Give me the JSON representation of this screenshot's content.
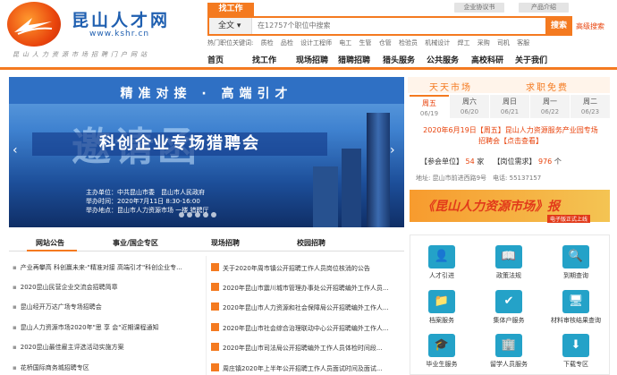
{
  "header": {
    "site_title": "昆山人才网",
    "site_url": "www.kshr.cn",
    "slogan": "昆山人力资源市场招聘门户网站",
    "search_tab": "找工作",
    "search_scope": "全文",
    "search_placeholder": "在12757个职位中搜索",
    "search_button": "搜索",
    "advanced_search": "高级搜索",
    "enterprise_btn": "企业协议书",
    "product_btn": "产品介绍",
    "hot_keywords_label": "热门职位关键词:",
    "hot_keywords": [
      "质检",
      "品检",
      "设计工程师",
      "电工",
      "生管",
      "仓管",
      "检验员",
      "机械设计",
      "焊工",
      "采购",
      "司机",
      "客服"
    ]
  },
  "nav": [
    "首页",
    "找工作",
    "现场招聘",
    "猎聘招聘",
    "猎头服务",
    "公共服务",
    "高校科研",
    "关于我们"
  ],
  "banner": {
    "tagline": "精准对接 · 高端引才",
    "big_text": "邀请函",
    "main_title": "科创企业专场猎聘会",
    "info": [
      "主办单位：中共昆山市委　昆山市人民政府",
      "举办时间：2020年7月11日 8:30-16:00",
      "举办地点：昆山市人力资源市场 一楼 猎聘厅"
    ]
  },
  "market": {
    "title_left": "天天市场",
    "title_right": "求职免费",
    "days": [
      {
        "name": "周五",
        "date": "06/19"
      },
      {
        "name": "周六",
        "date": "06/20"
      },
      {
        "name": "周日",
        "date": "06/21"
      },
      {
        "name": "周一",
        "date": "06/22"
      },
      {
        "name": "周二",
        "date": "06/23"
      }
    ],
    "event_line1": "2020年6月19日【周五】昆山人力资源服务产业园专场",
    "event_line2": "招聘会【点击查看】",
    "companies_label": "【参会单位】",
    "companies_count": "54",
    "companies_unit": "家",
    "jobs_label": "【岗位需求】",
    "jobs_count": "976",
    "jobs_unit": "个",
    "address": "地址: 昆山市前进西路9号　电话: 55137157",
    "banner_text": "《昆山人力资源市场》报",
    "banner_sub": "电子版正式上线"
  },
  "tabs": [
    "网站公告",
    "事业/国企专区",
    "现场招聘",
    "校园招聘"
  ],
  "notices": [
    "产业再攀高 科创赢未来-\"精准对接 高端引才\"科创企业专...",
    "2020昆山民营企业交流会招聘简章",
    "昆山经开万达广场专场招聘会",
    "昆山人力资源市场2020年\"思 享 会\"近期课程通知",
    "2020昆山最佳雇主评选活动实施方案",
    "花桥国际商务城招聘专区"
  ],
  "jobs": [
    "关于2020年周市镇公开招聘工作人员岗位核消的公告",
    "2020年昆山市震川城市管理办事处公开招聘编外工作人员...",
    "2020年昆山市人力资源和社会保障局公开招聘编外工作人...",
    "2020年昆山市社会综合治理联动中心公开招聘编外工作人...",
    "2020年昆山市司法局公开招聘编外工作人员体检时间段...",
    "周庄镇2020年上半年公开招聘工作人员面试时间及面试..."
  ],
  "services": [
    {
      "label": "人才引进",
      "icon": "person-icon"
    },
    {
      "label": "政策法规",
      "icon": "book-icon"
    },
    {
      "label": "到期查询",
      "icon": "search-icon"
    },
    {
      "label": "档案服务",
      "icon": "folder-icon"
    },
    {
      "label": "集体户服务",
      "icon": "check-icon"
    },
    {
      "label": "材料审核结果查询",
      "icon": "monitor-icon"
    },
    {
      "label": "毕业生服务",
      "icon": "graduate-icon"
    },
    {
      "label": "留学人员服务",
      "icon": "building-icon"
    },
    {
      "label": "下载专区",
      "icon": "download-icon"
    }
  ]
}
